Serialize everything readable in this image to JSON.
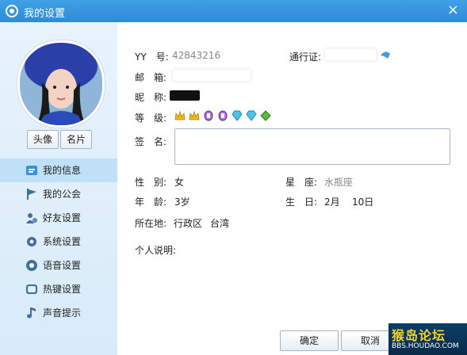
{
  "window": {
    "title": "我的设置",
    "close_glyph": "×"
  },
  "sidebar": {
    "avatar_button": "头像",
    "card_button": "名片",
    "items": [
      {
        "label": "我的信息",
        "icon": "info-card-icon",
        "active": true
      },
      {
        "label": "我的公会",
        "icon": "flag-icon",
        "active": false
      },
      {
        "label": "好友设置",
        "icon": "friends-icon",
        "active": false
      },
      {
        "label": "系统设置",
        "icon": "gear-icon",
        "active": false
      },
      {
        "label": "语音设置",
        "icon": "speaker-icon",
        "active": false
      },
      {
        "label": "热键设置",
        "icon": "keyboard-icon",
        "active": false
      },
      {
        "label": "声音提示",
        "icon": "music-note-icon",
        "active": false
      }
    ]
  },
  "profile": {
    "yy_label": "YY　号:",
    "yy_value": "42843216",
    "passport_label": "通行证:",
    "email_label": "邮　箱:",
    "nickname_label": "昵　称:",
    "level_label": "等　级:",
    "level_badges": [
      "crown-icon",
      "crown-icon",
      "gem-purple-icon",
      "gem-purple-icon",
      "diamond-blue-icon",
      "diamond-blue-icon",
      "clover-green-icon"
    ],
    "signature_label": "签　名:",
    "gender_label": "性　别:",
    "gender_value": "女",
    "star_label": "星　座:",
    "star_value": "水瓶座",
    "age_label": "年　龄:",
    "age_value": "3岁",
    "birthday_label": "生　日:",
    "birthday_month": "2月",
    "birthday_day": "10日",
    "location_label": "所在地:",
    "location_value": "行政区",
    "location_city": "台湾",
    "bio_label": "个人说明:"
  },
  "footer": {
    "ok_label": "确定",
    "cancel_label": "取消"
  },
  "watermark": {
    "title": "猴岛论坛",
    "url": "BBS.HOUDAO.COM"
  },
  "colors": {
    "titlebar": "#2e8bd6",
    "sidebar_bg": "#e0eefa",
    "active_item": "#bfe0f7"
  }
}
